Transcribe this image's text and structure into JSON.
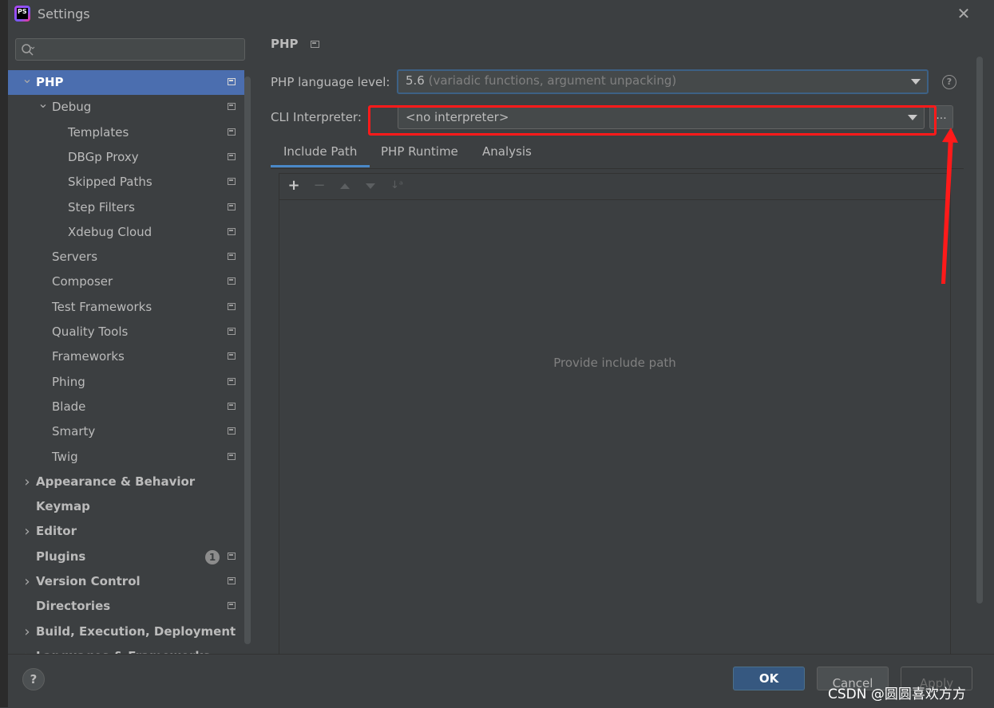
{
  "window": {
    "title": "Settings"
  },
  "search": {
    "placeholder": ""
  },
  "sidebar": {
    "items": [
      {
        "label": "PHP",
        "bold": true,
        "arrow": "down",
        "indent": 0,
        "selected": true,
        "proj": true
      },
      {
        "label": "Debug",
        "bold": false,
        "arrow": "down",
        "indent": 1,
        "proj": true
      },
      {
        "label": "Templates",
        "indent": 2,
        "proj": true
      },
      {
        "label": "DBGp Proxy",
        "indent": 2,
        "proj": true
      },
      {
        "label": "Skipped Paths",
        "indent": 2,
        "proj": true
      },
      {
        "label": "Step Filters",
        "indent": 2,
        "proj": true
      },
      {
        "label": "Xdebug Cloud",
        "indent": 2,
        "proj": true
      },
      {
        "label": "Servers",
        "indent": 1,
        "proj": true
      },
      {
        "label": "Composer",
        "indent": 1,
        "proj": true
      },
      {
        "label": "Test Frameworks",
        "indent": 1,
        "proj": true
      },
      {
        "label": "Quality Tools",
        "indent": 1,
        "proj": true
      },
      {
        "label": "Frameworks",
        "indent": 1,
        "proj": true
      },
      {
        "label": "Phing",
        "indent": 1,
        "proj": true
      },
      {
        "label": "Blade",
        "indent": 1,
        "proj": true
      },
      {
        "label": "Smarty",
        "indent": 1,
        "proj": true
      },
      {
        "label": "Twig",
        "indent": 1,
        "proj": true
      },
      {
        "label": "Appearance & Behavior",
        "bold": true,
        "arrow": "right",
        "indent": 0
      },
      {
        "label": "Keymap",
        "bold": true,
        "indent": 0
      },
      {
        "label": "Editor",
        "bold": true,
        "arrow": "right",
        "indent": 0
      },
      {
        "label": "Plugins",
        "bold": true,
        "indent": 0,
        "badge": "1",
        "proj": true
      },
      {
        "label": "Version Control",
        "bold": true,
        "arrow": "right",
        "indent": 0,
        "proj": true
      },
      {
        "label": "Directories",
        "bold": true,
        "indent": 0,
        "proj": true
      },
      {
        "label": "Build, Execution, Deployment",
        "bold": true,
        "arrow": "right",
        "indent": 0
      },
      {
        "label": "Languages & Frameworks",
        "bold": true,
        "arrow": "right",
        "indent": 0
      }
    ]
  },
  "main": {
    "section_title": "PHP",
    "language_level_label": "PHP language level:",
    "language_level_value": "5.6",
    "language_level_hint": " (variadic functions, argument unpacking)",
    "cli_label": "CLI Interpreter:",
    "cli_value": "<no interpreter>",
    "dots_label": "...",
    "help_label": "?",
    "tabs": [
      {
        "label": "Include Path",
        "active": true
      },
      {
        "label": "PHP Runtime"
      },
      {
        "label": "Analysis"
      }
    ],
    "empty_text": "Provide include path"
  },
  "footer": {
    "help_label": "?",
    "ok_label": "OK",
    "cancel_label": "Cancel",
    "apply_label": "Apply"
  },
  "watermark": "CSDN @圆圆喜欢方方",
  "colors": {
    "background": "#3c3f41",
    "selection": "#4b6eaf",
    "ok_button": "#365880",
    "annotation_red": "#ff1a1a",
    "tab_underline": "#4a88c7"
  },
  "icons": {
    "search": "magnifier-icon",
    "close": "close-icon",
    "add": "plus-icon",
    "remove": "minus-icon",
    "up": "move-up-icon",
    "down": "move-down-icon",
    "sort": "sort-az-icon"
  }
}
